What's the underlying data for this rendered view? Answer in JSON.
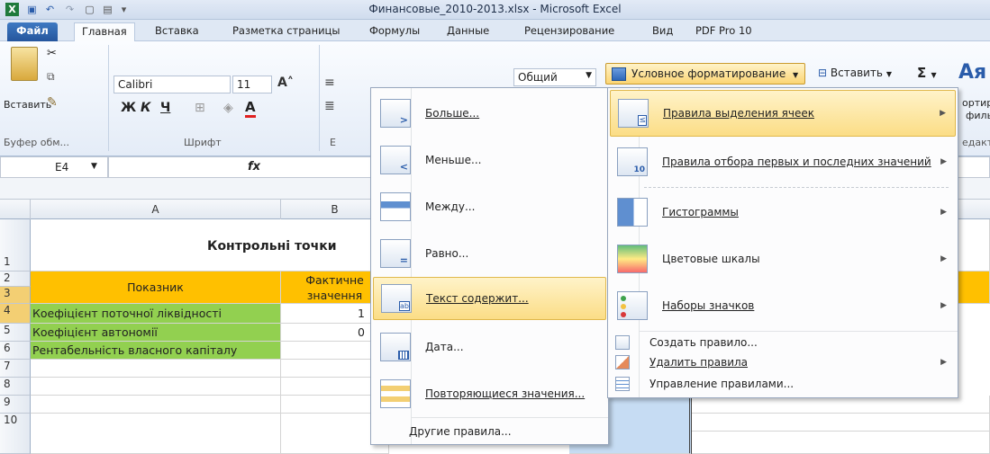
{
  "window": {
    "title": "Финансовые_2010-2013.xlsx - Microsoft Excel"
  },
  "tabs": [
    "Файл",
    "Главная",
    "Вставка",
    "Разметка страницы",
    "Формулы",
    "Данные",
    "Рецензирование",
    "Вид",
    "PDF Pro 10"
  ],
  "ribbon": {
    "paste_label": "Вставить",
    "clipboard_group": "Буфер обм...",
    "font_name": "Calibri",
    "font_size": "11",
    "bold": "Ж",
    "italic": "К",
    "underline": "Ч",
    "font_color_glyph": "A",
    "font_group": "Шрифт",
    "alignment_group_partial": "Е",
    "number_format": "Общий",
    "cond_format_button": "Условное форматирование",
    "insert_button": "Вставить",
    "sum_glyph": "Σ",
    "sort_partial_1": "ортир",
    "sort_partial_2": "филь",
    "edit_group_partial": "едакт"
  },
  "formula_bar": {
    "name_box": "E4",
    "fx": "fx"
  },
  "columns": [
    "A",
    "B"
  ],
  "rows": [
    "1",
    "2",
    "3",
    "4",
    "5",
    "6",
    "7",
    "8",
    "9",
    "10"
  ],
  "sheet": {
    "title_cell": "Контрольні точки",
    "header_a": "Показник",
    "header_b_line1": "Фактичне",
    "header_b_line2": "значення",
    "row4_a": "Коефіцієнт поточної ліквідності",
    "row4_b": "1",
    "row5_a": "Коефіцієнт автономії",
    "row5_b": "0",
    "row6_a": "Рентабельність власного капіталу"
  },
  "cond_menu": {
    "items": [
      {
        "label": "Правила выделения ячеек",
        "icon": "highlight-cells-rules-icon"
      },
      {
        "label": "Правила отбора первых и последних значений",
        "icon": "top-bottom-rules-icon"
      },
      {
        "label": "Гистограммы",
        "icon": "data-bars-icon"
      },
      {
        "label": "Цветовые шкалы",
        "icon": "color-scales-icon"
      },
      {
        "label": "Наборы значков",
        "icon": "icon-sets-icon"
      }
    ],
    "small_items": [
      {
        "label": "Создать правило...",
        "icon": "new-rule-icon"
      },
      {
        "label": "Удалить правила",
        "icon": "clear-rules-icon"
      },
      {
        "label": "Управление правилами...",
        "icon": "manage-rules-icon"
      }
    ]
  },
  "rules_submenu": {
    "items": [
      {
        "label": "Больше...",
        "icon": "greater-than-icon"
      },
      {
        "label": "Меньше...",
        "icon": "less-than-icon"
      },
      {
        "label": "Между...",
        "icon": "between-icon"
      },
      {
        "label": "Равно...",
        "icon": "equal-to-icon"
      },
      {
        "label": "Текст содержит...",
        "icon": "text-contains-icon"
      },
      {
        "label": "Дата...",
        "icon": "date-occurring-icon"
      },
      {
        "label": "Повторяющиеся значения...",
        "icon": "duplicate-values-icon"
      }
    ],
    "more_rules": "Другие правила..."
  },
  "colors": {
    "yellow_header": "#ffc000",
    "green_cells": "#92d050",
    "highlight": "#fbdd86",
    "selected_column": "#c6dcf3"
  }
}
